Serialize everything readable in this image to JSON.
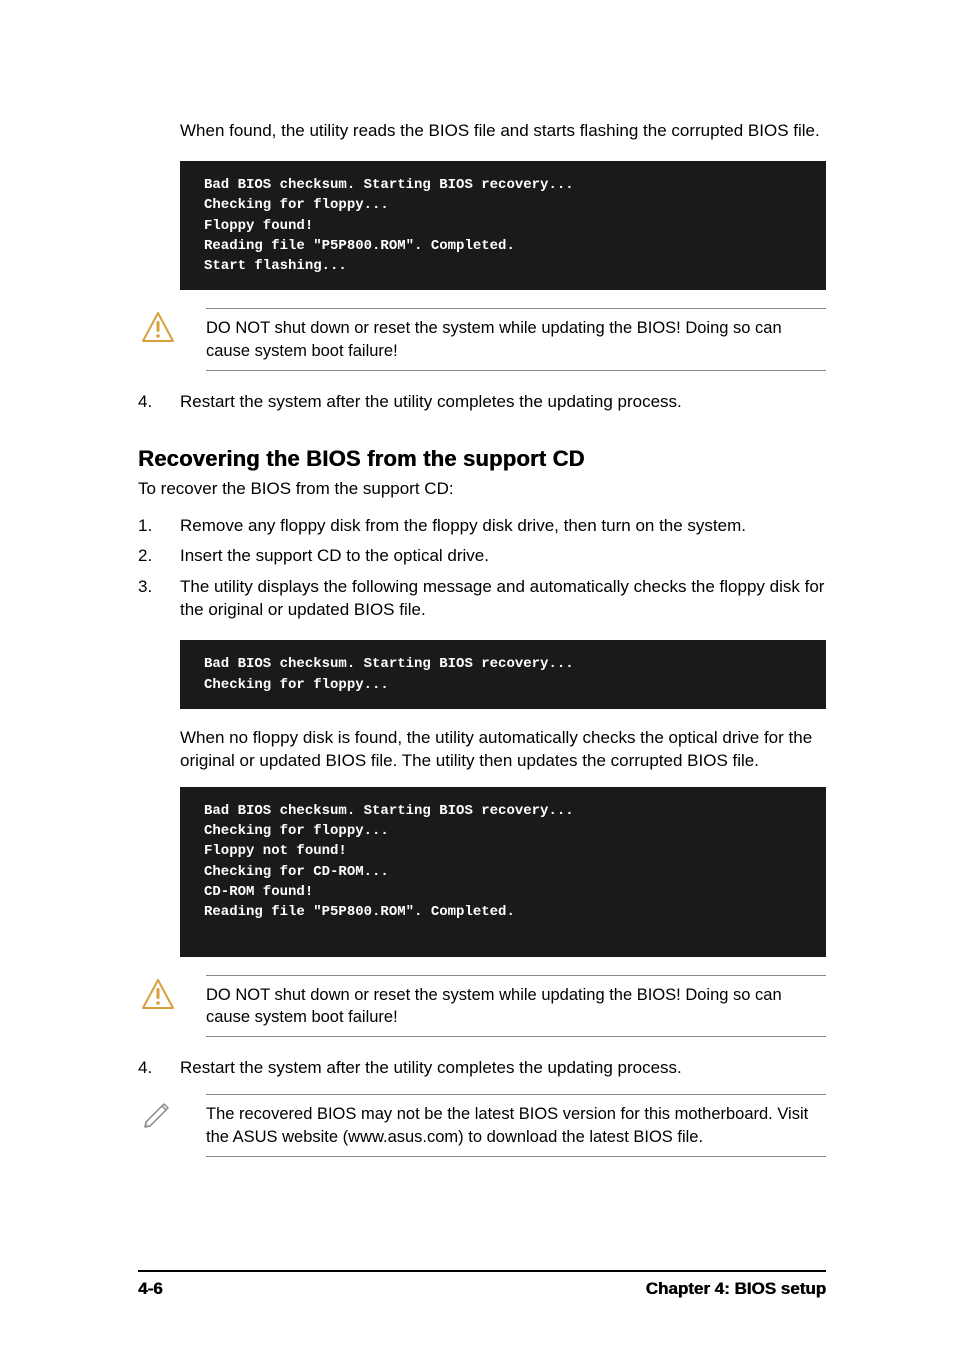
{
  "intro": "When found, the utility reads the BIOS file and starts flashing the corrupted BIOS file.",
  "code1": "Bad BIOS checksum. Starting BIOS recovery...\nChecking for floppy...\nFloppy found!\nReading file \"P5P800.ROM\". Completed.\nStart flashing...",
  "warn1": "DO NOT shut down or reset the system while updating the BIOS! Doing so can cause system boot failure!",
  "step_top_4_num": "4.",
  "step_top_4": "Restart the system after the utility completes the updating process.",
  "section_heading": "Recovering the BIOS from the support CD",
  "section_intro": "To recover the BIOS from the support CD:",
  "steps": {
    "s1_num": "1.",
    "s1": "Remove any floppy disk from the floppy disk drive, then turn on the system.",
    "s2_num": "2.",
    "s2": "Insert the support CD to the optical drive.",
    "s3_num": "3.",
    "s3": "The utility displays the following message and automatically checks the floppy disk for the original or updated BIOS file."
  },
  "code2": "Bad BIOS checksum. Starting BIOS recovery...\nChecking for floppy...",
  "after2": "When no floppy disk is found, the utility automatically checks the optical drive for the original or updated BIOS file. The utility then updates the corrupted BIOS file.",
  "code3": "Bad BIOS checksum. Starting BIOS recovery...\nChecking for floppy...\nFloppy not found!\nChecking for CD-ROM...\nCD-ROM found!\nReading file \"P5P800.ROM\". Completed.\n ",
  "warn2": "DO NOT shut down or reset the system while updating the BIOS! Doing so can cause system boot failure!",
  "step_bot_4_num": "4.",
  "step_bot_4": "Restart the system after the utility completes the updating process.",
  "note": "The recovered BIOS may not be the latest BIOS version for this motherboard. Visit the ASUS website (www.asus.com) to download the latest BIOS file.",
  "footer": {
    "left": "4-6",
    "right": "Chapter 4: BIOS setup"
  }
}
